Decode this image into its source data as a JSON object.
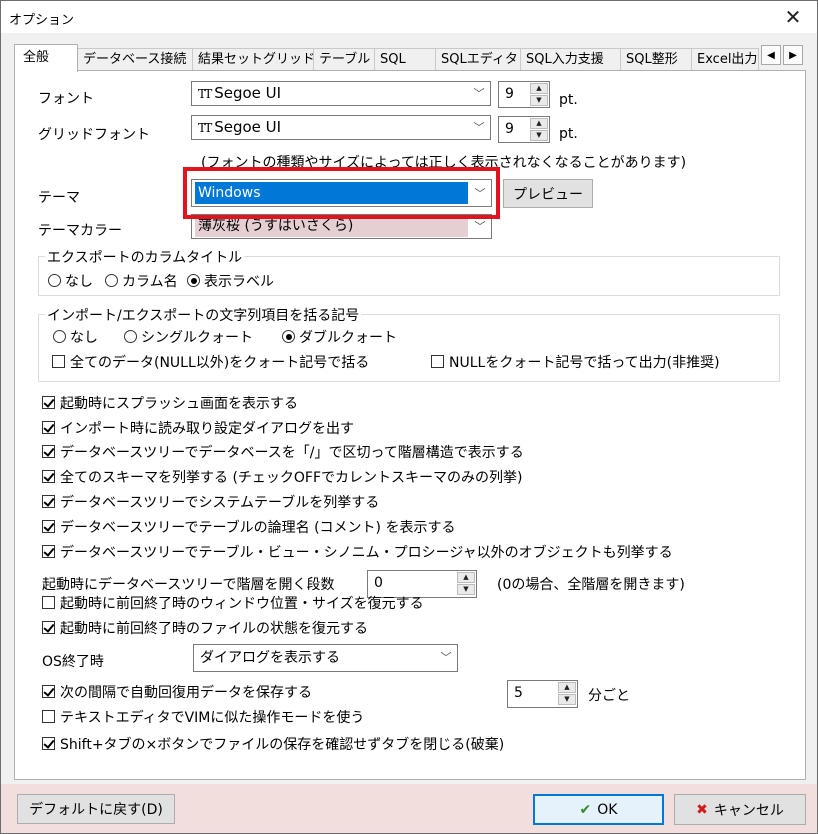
{
  "window": {
    "title": "オプション"
  },
  "tabs": [
    "全般",
    "データベース接続",
    "結果セットグリッド",
    "テーブル",
    "SQL",
    "SQLエディタ",
    "SQL入力支援",
    "SQL整形",
    "Excel出力"
  ],
  "fonts": {
    "font_label": "フォント",
    "font_value": "Segoe UI",
    "font_size": "9",
    "grid_font_label": "グリッドフォント",
    "grid_font_value": "Segoe UI",
    "grid_font_size": "9",
    "pt": "pt.",
    "note": "(フォントの種類やサイズによっては正しく表示されなくなることがあります)"
  },
  "theme": {
    "label": "テーマ",
    "value": "Windows",
    "preview_button": "プレビュー",
    "color_label": "テーマカラー",
    "color_value": "薄灰桜 (うすはいさくら)"
  },
  "export_title": {
    "legend": "エクスポートのカラムタイトル",
    "options": [
      "なし",
      "カラム名",
      "表示ラベル"
    ],
    "selected": 2
  },
  "quote": {
    "legend": "インポート/エクスポートの文字列項目を括る記号",
    "options": [
      "なし",
      "シングルクォート",
      "ダブルクォート"
    ],
    "selected": 2,
    "all_data": "全てのデータ(NULL以外)をクォート記号で括る",
    "null_quote": "NULLをクォート記号で括って出力(非推奨)"
  },
  "checks": [
    {
      "label": "起動時にスプラッシュ画面を表示する",
      "checked": true
    },
    {
      "label": "インポート時に読み取り設定ダイアログを出す",
      "checked": true
    },
    {
      "label": "データベースツリーでデータベースを「/」で区切って階層構造で表示する",
      "checked": true
    },
    {
      "label": "全てのスキーマを列挙する (チェックOFFでカレントスキーマのみの列挙)",
      "checked": true
    },
    {
      "label": "データベースツリーでシステムテーブルを列挙する",
      "checked": true
    },
    {
      "label": "データベースツリーでテーブルの論理名 (コメント) を表示する",
      "checked": true
    },
    {
      "label": "データベースツリーでテーブル・ビュー・シノニム・プロシージャ以外のオブジェクトも列挙する",
      "checked": true
    }
  ],
  "tree_depth": {
    "label": "起動時にデータベースツリーで階層を開く段数",
    "value": "0",
    "note": "(0の場合、全階層を開きます)"
  },
  "restore_window": {
    "label": "起動時に前回終了時のウィンドウ位置・サイズを復元する",
    "checked": false
  },
  "restore_files": {
    "label": "起動時に前回終了時のファイルの状態を復元する",
    "checked": true
  },
  "os_exit": {
    "label": "OS終了時",
    "value": "ダイアログを表示する"
  },
  "autosave": {
    "label": "次の間隔で自動回復用データを保存する",
    "checked": true,
    "value": "5",
    "unit": "分ごと"
  },
  "vim_mode": {
    "label": "テキストエディタでVIMに似た操作モードを使う",
    "checked": false
  },
  "shift_tab": {
    "label": "Shift+タブの×ボタンでファイルの保存を確認せずタブを閉じる(破棄)",
    "checked": true
  },
  "buttons": {
    "default": "デフォルトに戻す(D)",
    "ok": "OK",
    "cancel": "キャンセル"
  },
  "colors": {
    "accent": "#0078d7",
    "highlight": "#e0141e",
    "footer_bg": "#f3dede"
  }
}
